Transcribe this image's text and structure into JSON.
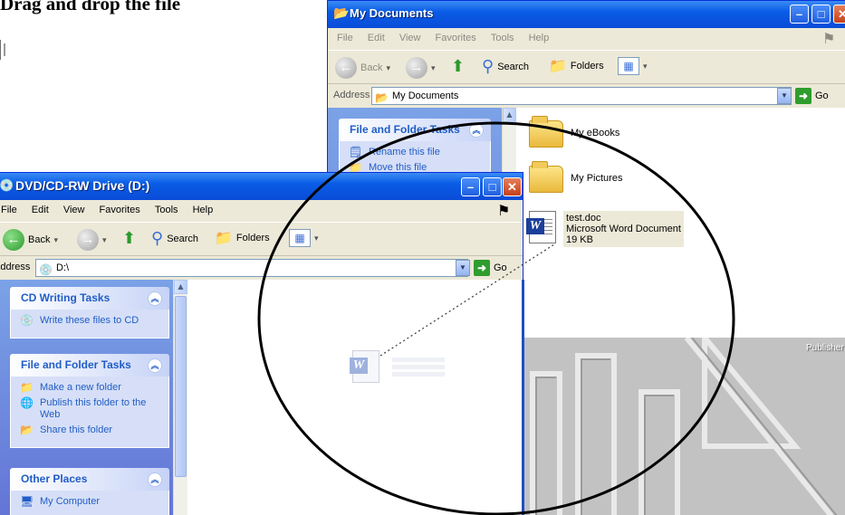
{
  "heading": "Drag and drop the file",
  "back_window": {
    "title": "My Documents",
    "menu": [
      "File",
      "Edit",
      "View",
      "Favorites",
      "Tools",
      "Help"
    ],
    "toolbar": {
      "back": "Back",
      "search": "Search",
      "folders": "Folders"
    },
    "address": {
      "label": "Address",
      "value": "My Documents",
      "go": "Go"
    },
    "panel": {
      "title": "File and Folder Tasks",
      "items": [
        "Rename this file",
        "Move this file"
      ]
    },
    "files": [
      {
        "name": "My eBooks"
      },
      {
        "name": "My Pictures"
      },
      {
        "name": "test.doc",
        "type": "Microsoft Word Document",
        "size": "19 KB"
      }
    ],
    "background_label": "Publisher"
  },
  "front_window": {
    "title": "DVD/CD-RW Drive (D:)",
    "menu": [
      "File",
      "Edit",
      "View",
      "Favorites",
      "Tools",
      "Help"
    ],
    "toolbar": {
      "back": "Back",
      "search": "Search",
      "folders": "Folders"
    },
    "address": {
      "label": "Address",
      "value": "D:\\",
      "go": "Go"
    },
    "panels": [
      {
        "title": "CD Writing Tasks",
        "items": [
          "Write these files to CD"
        ]
      },
      {
        "title": "File and Folder Tasks",
        "items": [
          "Make a new folder",
          "Publish this folder to the Web",
          "Share this folder"
        ]
      },
      {
        "title": "Other Places",
        "items": [
          "My Computer"
        ]
      }
    ]
  },
  "colors": {
    "titlebar": "#0a5ce6",
    "pane_blue": "#6375d6",
    "link": "#215dc6",
    "window_face": "#ece9d8"
  }
}
